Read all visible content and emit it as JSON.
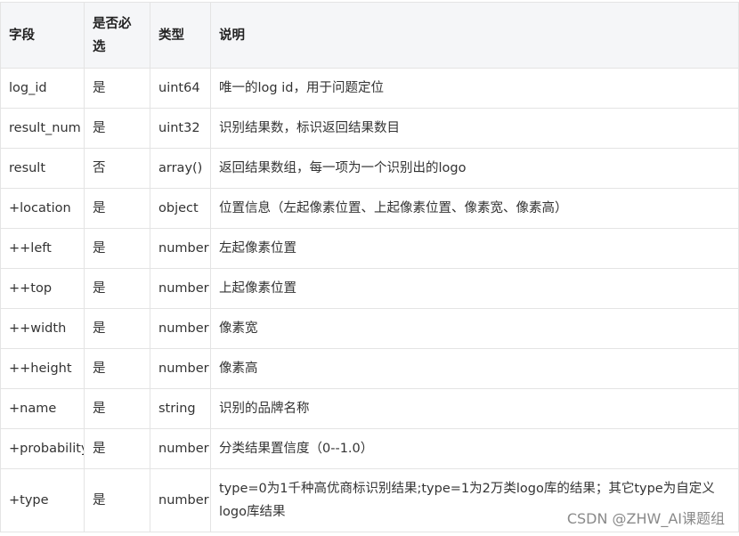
{
  "table": {
    "headers": [
      "字段",
      "是否必选",
      "类型",
      "说明"
    ],
    "rows": [
      [
        "log_id",
        "是",
        "uint64",
        "唯一的log id，用于问题定位"
      ],
      [
        "result_num",
        "是",
        "uint32",
        "识别结果数，标识返回结果数目"
      ],
      [
        "result",
        "否",
        "array()",
        "返回结果数组，每一项为一个识别出的logo"
      ],
      [
        "+location",
        "是",
        "object",
        "位置信息（左起像素位置、上起像素位置、像素宽、像素高）"
      ],
      [
        "++left",
        "是",
        "number",
        "左起像素位置"
      ],
      [
        "++top",
        "是",
        "number",
        "上起像素位置"
      ],
      [
        "++width",
        "是",
        "number",
        "像素宽"
      ],
      [
        "++height",
        "是",
        "number",
        "像素高"
      ],
      [
        "+name",
        "是",
        "string",
        "识别的品牌名称"
      ],
      [
        "+probability",
        "是",
        "number",
        "分类结果置信度（0--1.0）"
      ],
      [
        "+type",
        "是",
        "number",
        "type=0为1千种高优商标识别结果;type=1为2万类logo库的结果；其它type为自定义logo库结果"
      ]
    ]
  },
  "watermark": "CSDN @ZHW_AI课题组"
}
